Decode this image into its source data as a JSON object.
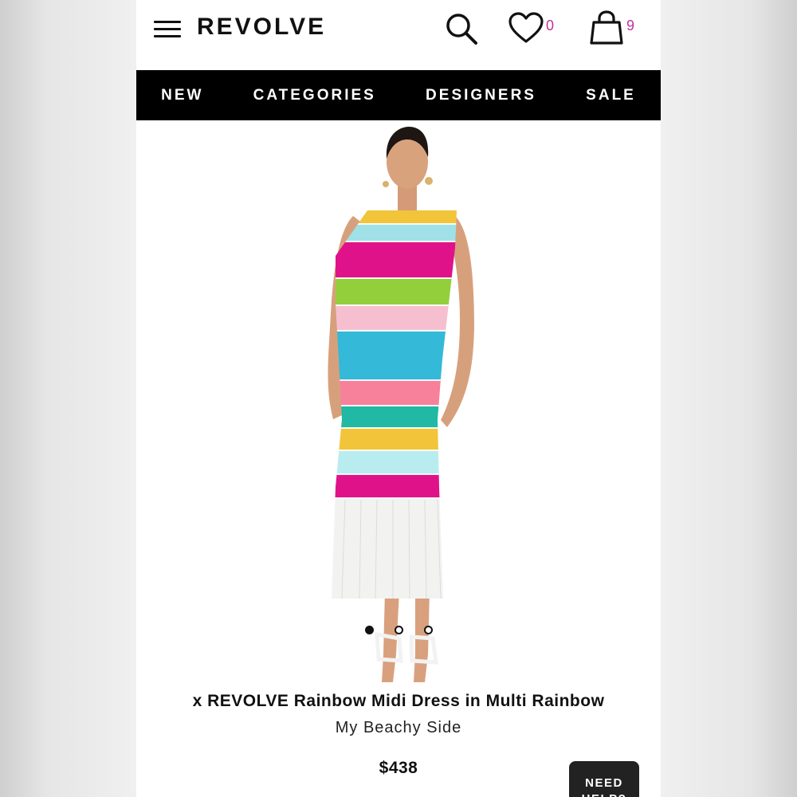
{
  "header": {
    "logo": "REVOLVE",
    "wishlist_count": "0",
    "bag_count": "9",
    "icons": [
      "menu-icon",
      "search-icon",
      "heart-icon",
      "shopping-bag-icon"
    ],
    "accent_color": "#c0339a"
  },
  "nav": {
    "items": [
      "NEW",
      "CATEGORIES",
      "DESIGNERS",
      "SALE"
    ]
  },
  "carousel": {
    "total": 3,
    "active_index": 0
  },
  "product": {
    "title": "x REVOLVE Rainbow Midi Dress in Multi Rainbow",
    "brand": "My Beachy Side",
    "price": "$438"
  },
  "help": {
    "label": "NEED HELP?"
  }
}
